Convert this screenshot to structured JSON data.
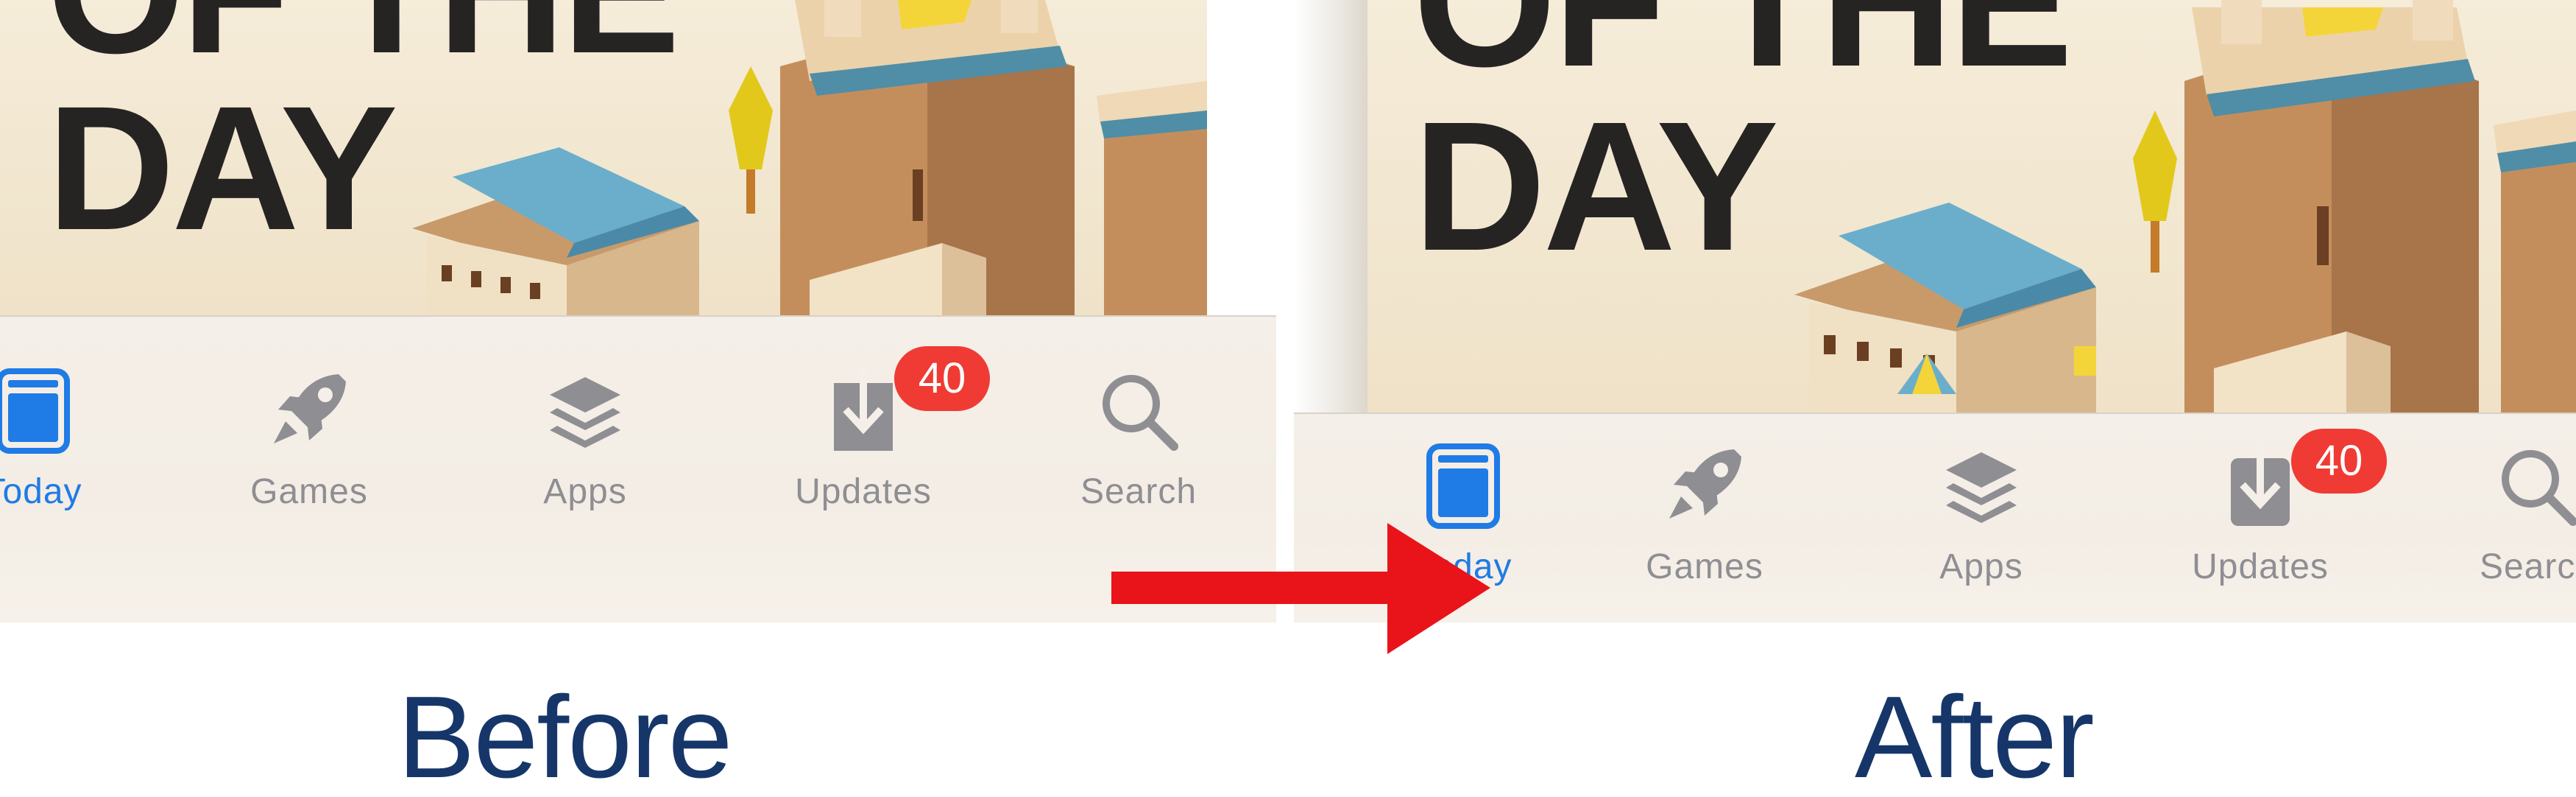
{
  "banner": {
    "line1": "OF THE",
    "line2": "DAY"
  },
  "before": {
    "tabs": [
      {
        "label": "Today",
        "icon": "today-icon",
        "active": true
      },
      {
        "label": "Games",
        "icon": "rocket-icon"
      },
      {
        "label": "Apps",
        "icon": "layers-icon"
      },
      {
        "label": "Updates",
        "icon": "download-icon",
        "badge": "40"
      },
      {
        "label": "Search",
        "icon": "search-icon"
      }
    ]
  },
  "after": {
    "tabs": [
      {
        "label": "Today",
        "icon": "today-icon",
        "active": true
      },
      {
        "label": "Games",
        "icon": "rocket-icon"
      },
      {
        "label": "Apps",
        "icon": "layers-icon"
      },
      {
        "label": "Updates",
        "icon": "download-icon",
        "badge": "40"
      },
      {
        "label": "Search",
        "icon": "search-icon"
      }
    ]
  },
  "captions": {
    "before": "Before",
    "after": "After"
  },
  "colors": {
    "accent_blue": "#1f7be5",
    "badge_red": "#ef3b34",
    "arrow_red": "#e8141a",
    "caption_navy": "#16366a",
    "inactive_gray": "#8e8e93"
  }
}
